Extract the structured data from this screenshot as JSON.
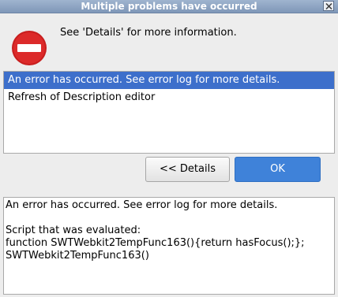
{
  "window": {
    "title": "Multiple problems have occurred"
  },
  "summary": {
    "text": "See 'Details' for more information."
  },
  "errors_list": {
    "items": [
      {
        "label": "An error has occurred. See error log for more details.",
        "selected": true
      },
      {
        "label": "Refresh of Description editor",
        "selected": false
      }
    ]
  },
  "buttons": {
    "details_label": "<< Details",
    "ok_label": "OK"
  },
  "details": {
    "text": "An error has occurred. See error log for more details.\n\nScript that was evaluated:\nfunction SWTWebkit2TempFunc163(){return hasFocus();};\nSWTWebkit2TempFunc163()"
  },
  "icons": {
    "error": "error-stop-icon",
    "close": "close-icon"
  },
  "colors": {
    "error_red": "#d42020",
    "selection": "#3d6fcb",
    "ok_button": "#3f82d9"
  }
}
